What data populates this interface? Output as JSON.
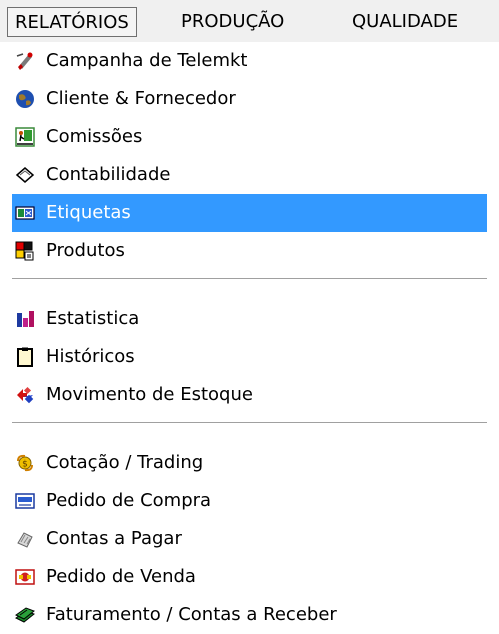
{
  "menubar": {
    "items": [
      {
        "label": "RELATÓRIOS",
        "active": true
      },
      {
        "label": "PRODUÇÃO",
        "active": false
      },
      {
        "label": "QUALIDADE",
        "active": false
      }
    ]
  },
  "dropdown": {
    "groups": [
      [
        {
          "label": "Campanha de Telemkt",
          "icon": "phone-icon"
        },
        {
          "label": "Cliente & Fornecedor",
          "icon": "globe-icon"
        },
        {
          "label": "Comissões",
          "icon": "commission-icon"
        },
        {
          "label": "Contabilidade",
          "icon": "ledger-icon"
        },
        {
          "label": "Etiquetas",
          "icon": "label-tag-icon",
          "highlighted": true
        },
        {
          "label": "Produtos",
          "icon": "products-icon"
        }
      ],
      [
        {
          "label": "Estatistica",
          "icon": "bar-chart-icon"
        },
        {
          "label": "Históricos",
          "icon": "clipboard-icon"
        },
        {
          "label": "Movimento de Estoque",
          "icon": "stock-movement-icon"
        }
      ],
      [
        {
          "label": "Cotação / Trading",
          "icon": "trading-icon"
        },
        {
          "label": "Pedido de Compra",
          "icon": "purchase-order-icon"
        },
        {
          "label": "Contas a Pagar",
          "icon": "accounts-payable-icon"
        },
        {
          "label": "Pedido de Venda",
          "icon": "sales-order-icon"
        },
        {
          "label": "Faturamento / Contas a Receber",
          "icon": "invoice-receivable-icon"
        }
      ]
    ]
  },
  "colors": {
    "highlight": "#3399ff",
    "menubar_bg": "#f0f0f0"
  }
}
